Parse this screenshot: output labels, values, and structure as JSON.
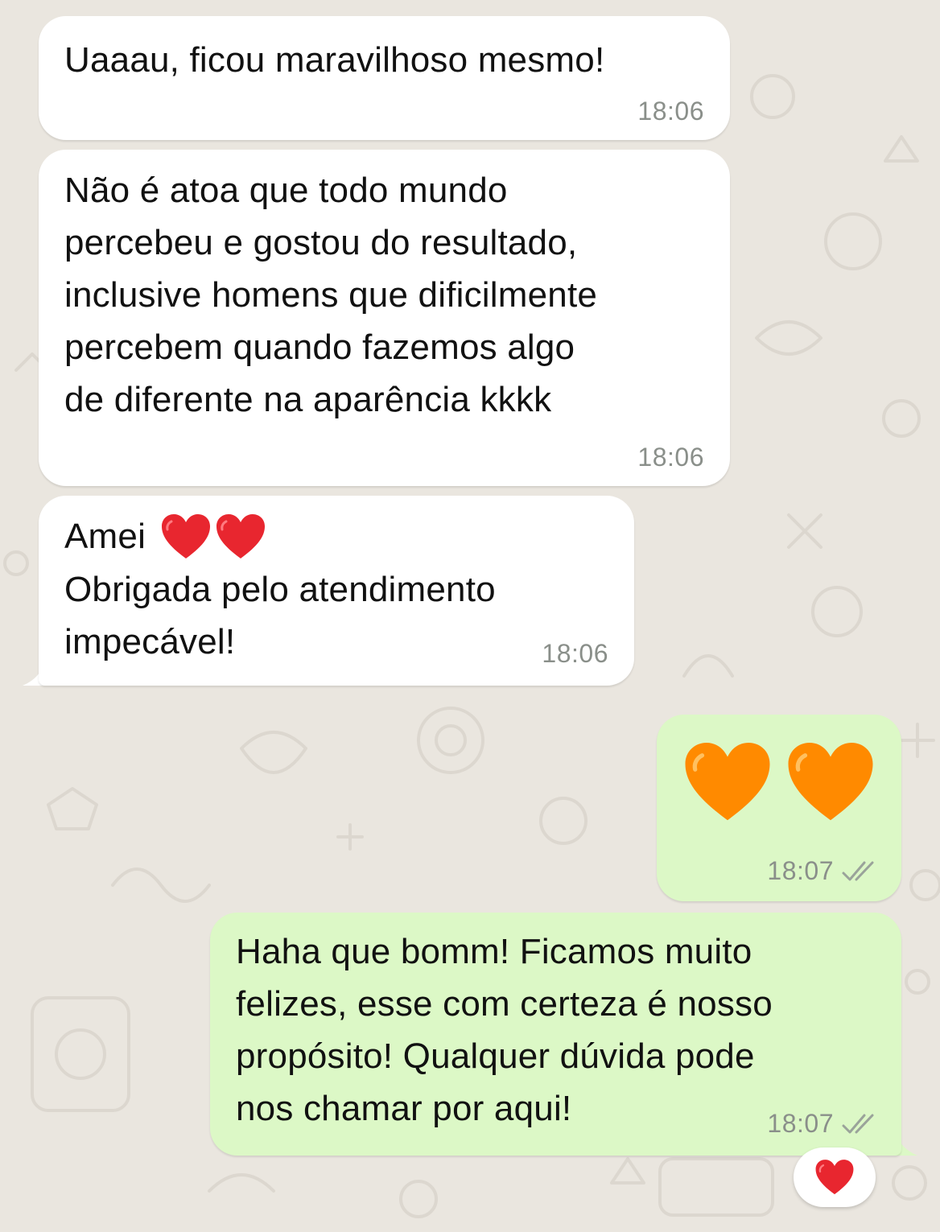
{
  "chat": {
    "messages": [
      {
        "direction": "incoming",
        "text": "Uaaau, ficou maravilhoso mesmo!",
        "time": "18:06"
      },
      {
        "direction": "incoming",
        "text": "Não é atoa que todo mundo\npercebeu e gostou do resultado,\ninclusive homens que dificilmente\npercebem quando fazemos algo\nde diferente na aparência kkkk",
        "time": "18:06"
      },
      {
        "direction": "incoming",
        "text_line1": "Amei",
        "text_rest": "Obrigada pelo atendimento\nimpecável!",
        "emoji": "red-heart-icon",
        "emoji_count": 2,
        "time": "18:06"
      },
      {
        "direction": "outgoing",
        "emoji": "orange-heart-icon",
        "emoji_count": 2,
        "time": "18:07",
        "status": "read-double-check"
      },
      {
        "direction": "outgoing",
        "text": "Haha que bomm! Ficamos muito\nfelizes, esse com certeza é nosso\npropósito! Qualquer dúvida pode\nnos chamar por aqui!",
        "time": "18:07",
        "status": "read-double-check",
        "reaction": "red-heart-icon"
      }
    ]
  },
  "colors": {
    "background": "#eae6df",
    "incoming_bubble": "#ffffff",
    "outgoing_bubble": "#dcf8c6",
    "timestamp": "#8a8f8a",
    "red_heart": "#e8262f",
    "orange_heart": "#ff8a00"
  }
}
